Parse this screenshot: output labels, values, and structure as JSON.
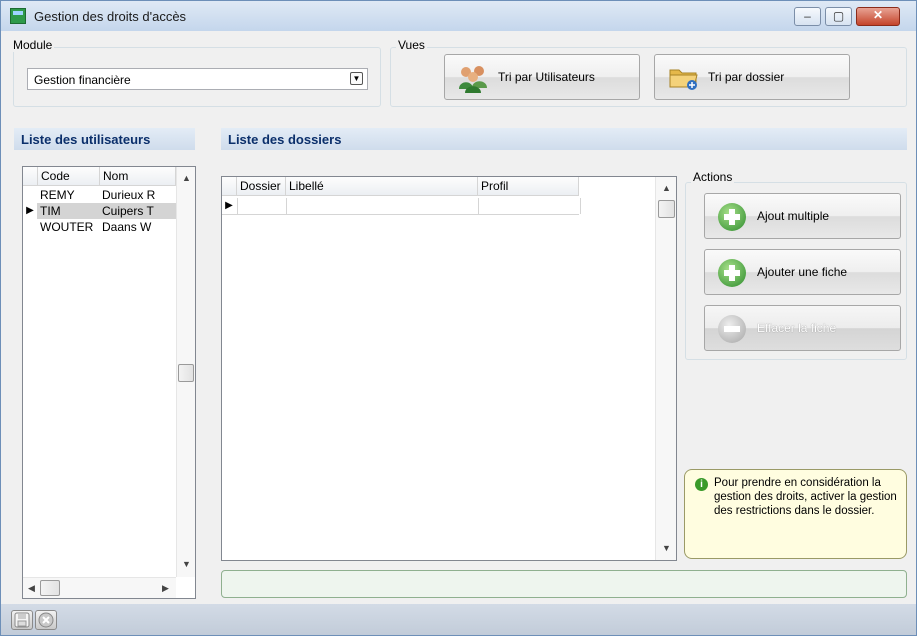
{
  "window": {
    "title": "Gestion des droits d'accès",
    "min_glyph": "‒",
    "max_glyph": "▢",
    "close_glyph": "✕"
  },
  "module": {
    "label": "Module",
    "selected": "Gestion financière",
    "dropdown_glyph": "▼"
  },
  "vues": {
    "label": "Vues",
    "btn_users": "Tri par Utilisateurs",
    "btn_folder": "Tri par dossier"
  },
  "users": {
    "title": "Liste des utilisateurs",
    "columns": [
      "Code",
      "Nom"
    ],
    "rows": [
      {
        "code": "REMY",
        "nom": "Durieux R"
      },
      {
        "code": "TIM",
        "nom": "Cuipers T"
      },
      {
        "code": "WOUTER",
        "nom": "Daans W"
      }
    ],
    "selected_row_indicator": "▶",
    "scroll_up": "▲",
    "scroll_down": "▼",
    "scroll_left": "◀",
    "scroll_right": "▶"
  },
  "dossiers": {
    "title": "Liste des dossiers",
    "columns": [
      "Dossier",
      "Libellé",
      "Profil"
    ],
    "row_indicator": "▶",
    "scroll_up": "▲",
    "scroll_down": "▼"
  },
  "actions": {
    "label": "Actions",
    "ajout_multiple": "Ajout multiple",
    "ajouter_fiche": "Ajouter une fiche",
    "effacer_fiche": "Effacer la fiche"
  },
  "info": {
    "icon_glyph": "i",
    "text": "Pour prendre en considération la gestion des droits, activer la gestion des restrictions dans le dossier."
  },
  "icons": {
    "app": "app-icon",
    "users": "users-group-icon",
    "folder": "folder-icon",
    "add": "plus-circle-icon",
    "remove": "minus-circle-icon",
    "info": "info-icon",
    "save": "save-icon",
    "close_tool": "close-circle-icon"
  }
}
